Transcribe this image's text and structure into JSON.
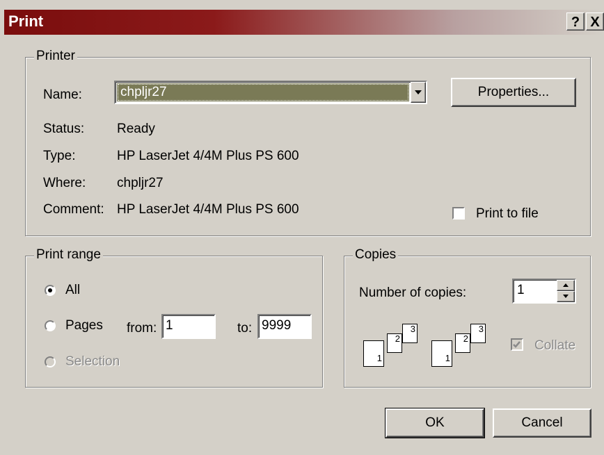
{
  "title": "Print",
  "title_buttons": {
    "help": "?",
    "close": "X"
  },
  "printer": {
    "legend": "Printer",
    "name_label": "Name:",
    "name_value": "chpljr27",
    "properties_button": "Properties...",
    "status_label": "Status:",
    "status_value": "Ready",
    "type_label": "Type:",
    "type_value": "HP LaserJet 4/4M Plus PS 600",
    "where_label": "Where:",
    "where_value": "chpljr27",
    "comment_label": "Comment:",
    "comment_value": "HP LaserJet 4/4M Plus PS 600",
    "print_to_file": "Print to file"
  },
  "range": {
    "legend": "Print range",
    "all": "All",
    "pages": "Pages",
    "from_label": "from:",
    "from_value": "1",
    "to_label": "to:",
    "to_value": "9999",
    "selection": "Selection",
    "selected": "all"
  },
  "copies": {
    "legend": "Copies",
    "number_label": "Number of copies:",
    "number_value": "1",
    "collate": "Collate",
    "collate_checked": true,
    "pages_icon": [
      "1",
      "2",
      "3"
    ]
  },
  "buttons": {
    "ok": "OK",
    "cancel": "Cancel"
  },
  "colors": {
    "face": "#d4d0c8",
    "title_start": "#7a0d0d",
    "selection_bg": "#7a7a56"
  }
}
